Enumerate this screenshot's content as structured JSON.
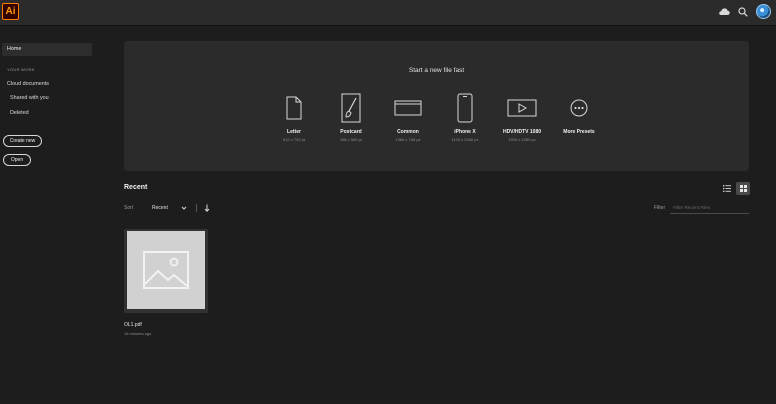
{
  "app": {
    "logo_text": "Ai",
    "brand_color": "#ff9a00"
  },
  "topbar": {
    "icons": [
      "cloud-icon",
      "search-icon",
      "avatar"
    ]
  },
  "sidebar": {
    "home": "Home",
    "section_label": "YOUR WORK",
    "items": [
      {
        "label": "Cloud documents"
      },
      {
        "label": "Shared with you"
      },
      {
        "label": "Deleted"
      }
    ],
    "create_new": "Create new",
    "open": "Open"
  },
  "presets": {
    "title": "Start a new file fast",
    "items": [
      {
        "name": "Letter",
        "dims": "612 x 792 pt",
        "icon": "document-icon"
      },
      {
        "name": "Postcard",
        "dims": "288 x 560 pt",
        "icon": "brush-icon"
      },
      {
        "name": "Common",
        "dims": "1366 x 768 px",
        "icon": "monitor-icon"
      },
      {
        "name": "iPhone X",
        "dims": "1125 x 2436 px",
        "icon": "phone-icon"
      },
      {
        "name": "HDV/HDTV 1080",
        "dims": "1920 x 1080 px",
        "icon": "video-icon"
      },
      {
        "name": "More Presets",
        "dims": "",
        "icon": "more-icon"
      }
    ]
  },
  "recent": {
    "title": "Recent",
    "sort_label": "Sort",
    "sort_value": "Recent",
    "filter_label": "Filter",
    "filter_placeholder": "Filter Recent Files",
    "files": [
      {
        "name": "OL1.pdf",
        "time": "16 minutes ago"
      }
    ]
  }
}
